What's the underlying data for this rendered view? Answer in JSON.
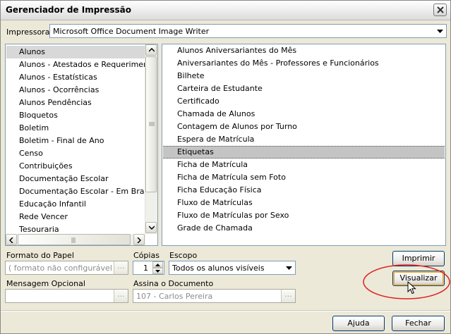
{
  "window": {
    "title": "Gerenciador de Impressão"
  },
  "printer": {
    "label": "Impressora",
    "value": "Microsoft Office Document Image Writer"
  },
  "left_list": {
    "items": [
      "Alunos",
      "Alunos - Atestados e Requerimentos",
      "Alunos - Estatísticas",
      "Alunos - Ocorrências",
      "Alunos Pendências",
      "Bloquetos",
      "Boletim",
      "Boletim - Final de Ano",
      "Censo",
      "Contribuições",
      "Documentação Escolar",
      "Documentação Escolar - Em Branco",
      "Educação Infantil",
      "Rede Vencer",
      "Tesouraria"
    ],
    "selected_index": 0
  },
  "right_list": {
    "items": [
      "Alunos Aniversariantes do Mês",
      "Aniversariantes do Mês - Professores e Funcionários",
      "Bilhete",
      "Carteira de Estudante",
      "Certificado",
      "Chamada de Alunos",
      "Contagem de Alunos por Turno",
      "Espera de Matrícula",
      "Etiquetas",
      "Ficha de Matrícula",
      "Ficha de Matrícula sem Foto",
      "Ficha Educação Física",
      "Fluxo de Matrículas",
      "Fluxo de Matrículas por Sexo",
      "Grade de Chamada"
    ],
    "selected_index": 8
  },
  "form": {
    "paper_format": {
      "label": "Formato do Papel",
      "value": "( formato não configurável )",
      "button": "..."
    },
    "copies": {
      "label": "Cópias",
      "value": "1"
    },
    "scope": {
      "label": "Escopo",
      "value": "Todos os alunos visíveis"
    },
    "optional_message": {
      "label": "Mensagem Opcional",
      "value": "",
      "button": "..."
    },
    "signer": {
      "label": "Assina o Documento",
      "value": "107 - Carlos Pereira",
      "button": "..."
    }
  },
  "buttons": {
    "print": "Imprimir",
    "preview": "Visualizar",
    "help": "Ajuda",
    "close": "Fechar"
  },
  "colors": {
    "annotation_circle": "#e02020",
    "selection": "#c4c4c4",
    "border": "#7f9db9"
  }
}
